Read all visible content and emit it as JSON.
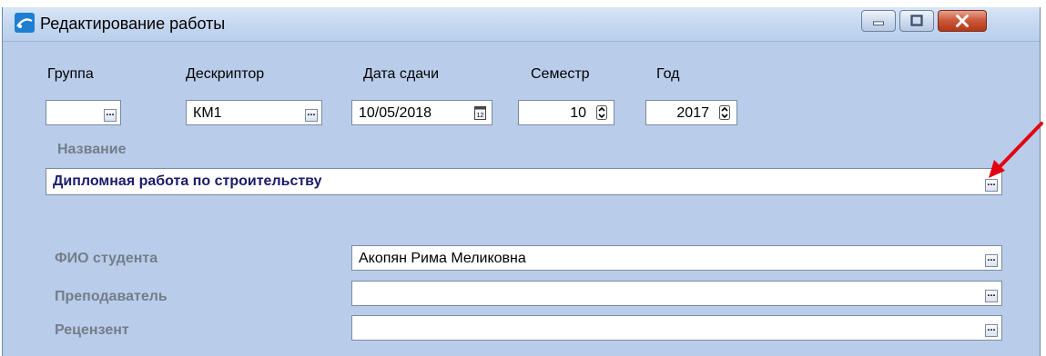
{
  "window": {
    "title": "Редактирование работы",
    "controls": {
      "minimize_icon": "minimize-icon",
      "maximize_icon": "maximize-icon",
      "close_icon": "close-icon"
    }
  },
  "form": {
    "group": {
      "label": "Группа",
      "value": ""
    },
    "descriptor": {
      "label": "Дескриптор",
      "value": "КМ1"
    },
    "due_date": {
      "label": "Дата сдачи",
      "value": "10/05/2018",
      "icon": "calendar-icon"
    },
    "semester": {
      "label": "Семестр",
      "value": "10"
    },
    "year": {
      "label": "Год",
      "value": "2017"
    },
    "name": {
      "label": "Название",
      "value": "Дипломная работа по строительству"
    },
    "student": {
      "label": "ФИО студента",
      "value": "Акопян Рима Меликовна"
    },
    "teacher": {
      "label": "Преподаватель",
      "value": ""
    },
    "reviewer": {
      "label": "Рецензент",
      "value": ""
    },
    "browse_label": "..."
  },
  "annotation": {
    "color": "#e3000f",
    "icon": "arrow-annotation"
  },
  "colors": {
    "window_bg": "#b9cdea",
    "close_red": "#c8432a"
  }
}
